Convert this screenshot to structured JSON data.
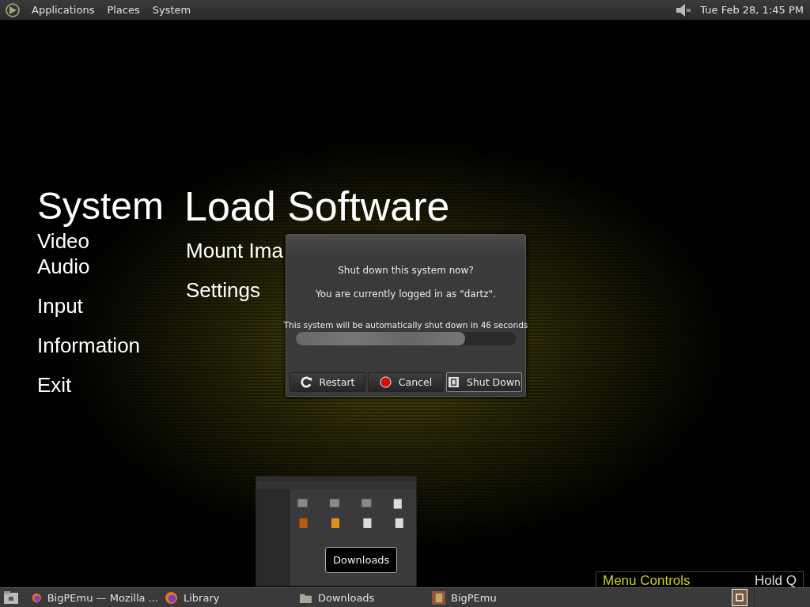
{
  "top_panel": {
    "menus": [
      "Applications",
      "Places",
      "System"
    ],
    "clock": "Tue Feb 28, 1:45 PM"
  },
  "app_menu": {
    "columns": [
      {
        "heading": "System",
        "items": [
          "Video",
          "Audio",
          "Input",
          "Information",
          "Exit"
        ]
      },
      {
        "heading": "Load Software",
        "items": [
          "Mount Ima",
          "Settings"
        ]
      }
    ]
  },
  "hint": {
    "label": "Menu Controls",
    "key": "Hold Q"
  },
  "dialog": {
    "title": "Shut down this system now?",
    "message": "You are currently logged in as \"dartz\".",
    "countdown": "This system will be automatically shut down in 46 seconds",
    "level": 0.77,
    "buttons": [
      {
        "label": "Restart",
        "kind": "restart",
        "selected": false
      },
      {
        "label": "Cancel",
        "kind": "cancel",
        "selected": false
      },
      {
        "label": "Shut Down",
        "kind": "shutdown",
        "selected": true
      }
    ]
  },
  "window_preview": {
    "label": "Downloads"
  },
  "taskbar": {
    "tasks": [
      {
        "label": "BigPEmu — Mozilla ...",
        "kind": "browser"
      },
      {
        "label": "Library",
        "kind": "browser"
      },
      {
        "label": "Downloads",
        "kind": "folder"
      },
      {
        "label": "BigPEmu",
        "kind": "app"
      }
    ]
  }
}
